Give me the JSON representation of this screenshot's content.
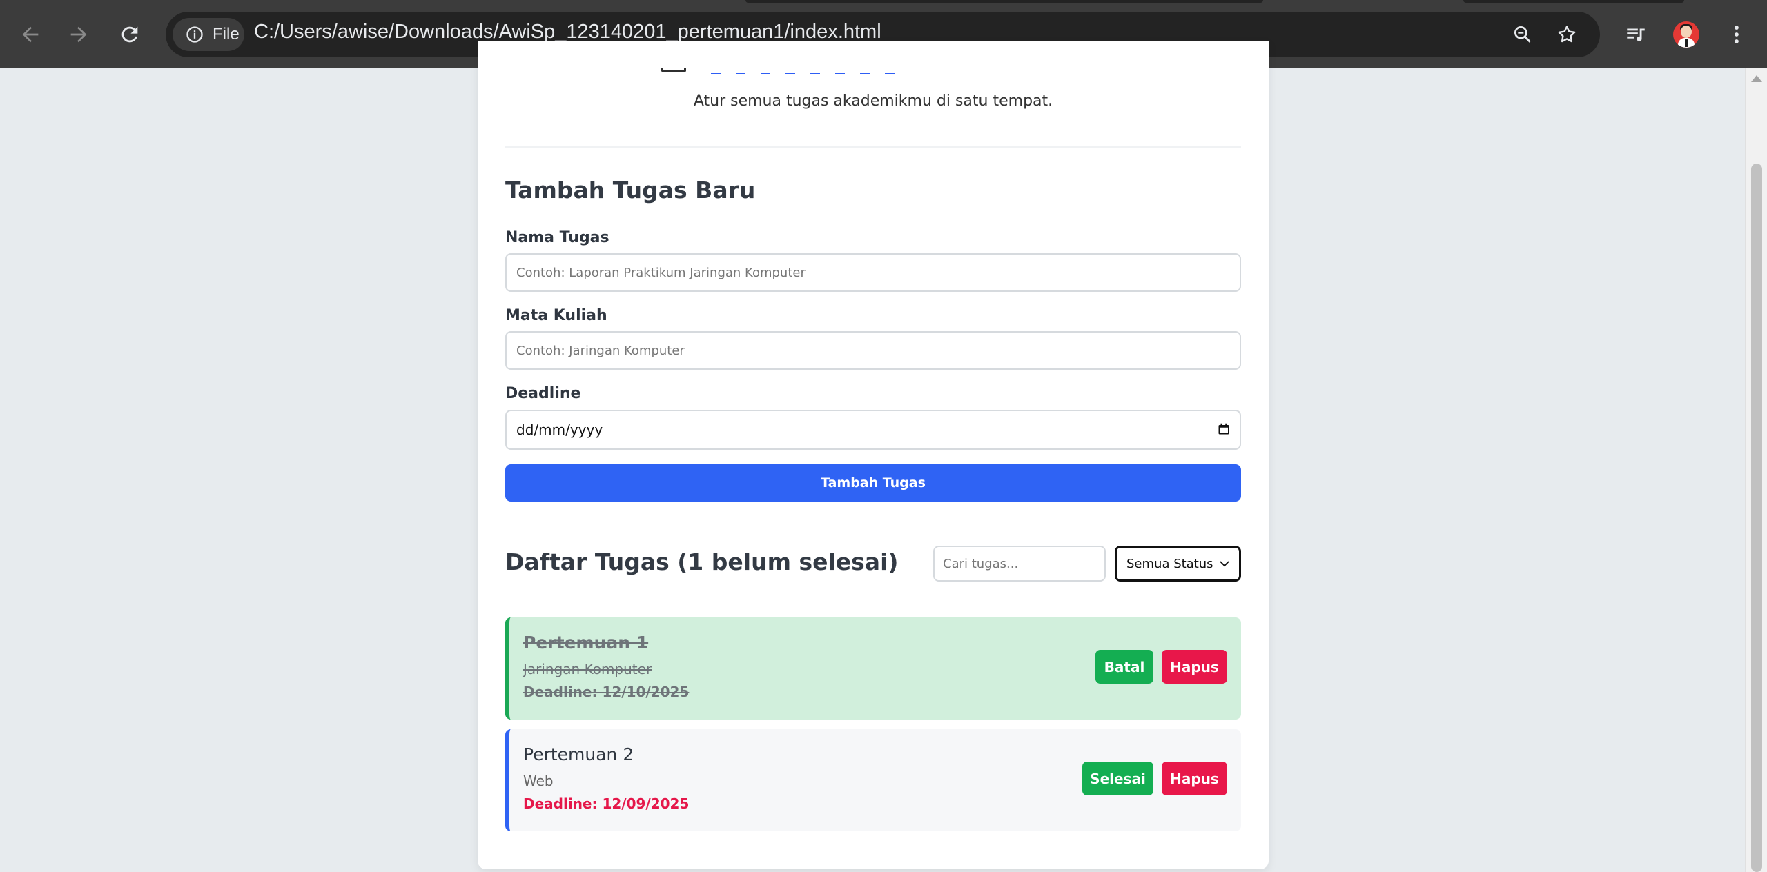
{
  "browser": {
    "site_chip_label": "File",
    "url": "C:/Users/awise/Downloads/AwiSp_123140201_pertemuan1/index.html"
  },
  "header": {
    "subtitle": "Atur semua tugas akademikmu di satu tempat."
  },
  "form": {
    "title": "Tambah Tugas Baru",
    "name_label": "Nama Tugas",
    "name_placeholder": "Contoh: Laporan Praktikum Jaringan Komputer",
    "course_label": "Mata Kuliah",
    "course_placeholder": "Contoh: Jaringan Komputer",
    "deadline_label": "Deadline",
    "deadline_placeholder": "dd/mm/yyyy",
    "submit_label": "Tambah Tugas"
  },
  "list": {
    "title": "Daftar Tugas (1 belum selesai)",
    "search_placeholder": "Cari tugas...",
    "status_filter": "Semua Status",
    "tasks": [
      {
        "title": "Pertemuan 1",
        "course": "Jaringan Komputer",
        "deadline": "Deadline: 12/10/2025",
        "done": true,
        "toggle_label": "Batal",
        "delete_label": "Hapus"
      },
      {
        "title": "Pertemuan 2",
        "course": "Web",
        "deadline": "Deadline: 12/09/2025",
        "done": false,
        "toggle_label": "Selesai",
        "delete_label": "Hapus"
      }
    ]
  },
  "colors": {
    "primary": "#2f63f4",
    "success": "#14ae52",
    "danger": "#e8174a",
    "done_bg": "#d1efdc"
  }
}
